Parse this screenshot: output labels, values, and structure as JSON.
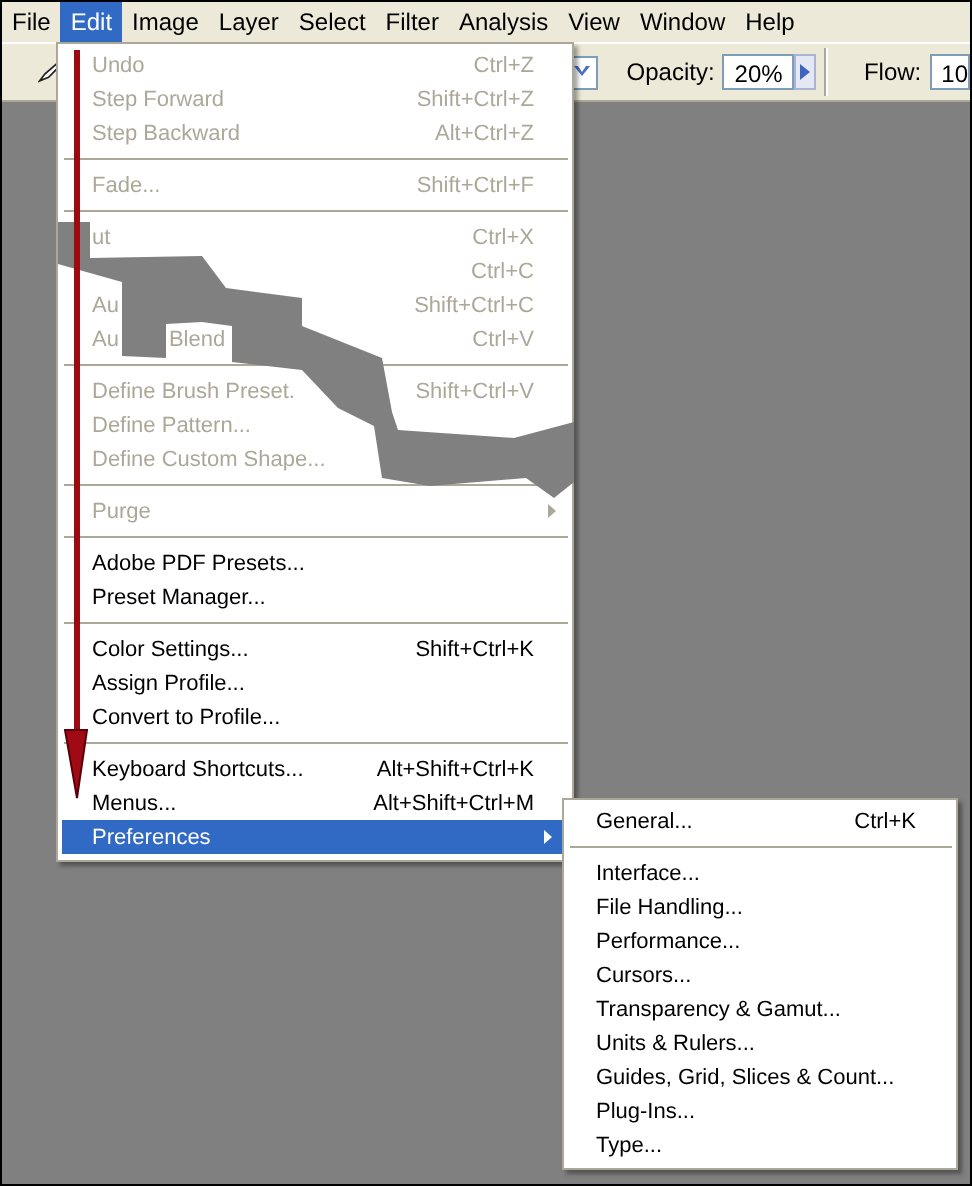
{
  "menubar": [
    {
      "label": "File",
      "selected": false
    },
    {
      "label": "Edit",
      "selected": true
    },
    {
      "label": "Image",
      "selected": false
    },
    {
      "label": "Layer",
      "selected": false
    },
    {
      "label": "Select",
      "selected": false
    },
    {
      "label": "Filter",
      "selected": false
    },
    {
      "label": "Analysis",
      "selected": false
    },
    {
      "label": "View",
      "selected": false
    },
    {
      "label": "Window",
      "selected": false
    },
    {
      "label": "Help",
      "selected": false
    }
  ],
  "toolbar": {
    "opacity": {
      "label": "Opacity:",
      "value": "20%"
    },
    "flow": {
      "label": "Flow:",
      "value": "10"
    }
  },
  "edit_menu": {
    "items": [
      {
        "kind": "item",
        "label": "Undo",
        "shortcut": "Ctrl+Z",
        "disabled": true,
        "submenu": false,
        "selected": false
      },
      {
        "kind": "item",
        "label": "Step Forward",
        "shortcut": "Shift+Ctrl+Z",
        "disabled": true,
        "submenu": false,
        "selected": false
      },
      {
        "kind": "item",
        "label": "Step Backward",
        "shortcut": "Alt+Ctrl+Z",
        "disabled": true,
        "submenu": false,
        "selected": false
      },
      {
        "kind": "separator"
      },
      {
        "kind": "item",
        "label": "Fade...",
        "shortcut": "Shift+Ctrl+F",
        "disabled": true,
        "submenu": false,
        "selected": false
      },
      {
        "kind": "separator"
      },
      {
        "kind": "item",
        "label": "ut",
        "shortcut": "Ctrl+X",
        "disabled": true,
        "submenu": false,
        "selected": false
      },
      {
        "kind": "item",
        "shortcut": "Ctrl+C",
        "disabled": true,
        "submenu": false,
        "selected": false
      },
      {
        "kind": "item",
        "label": "Au",
        "shortcut": "Shift+Ctrl+C",
        "disabled": true,
        "submenu": false,
        "selected": false
      },
      {
        "kind": "item",
        "label": "Au",
        "label_2": "Blend",
        "shortcut": "Ctrl+V",
        "disabled": true,
        "submenu": false,
        "selected": false
      },
      {
        "kind": "separator"
      },
      {
        "kind": "item",
        "label": "Define Brush Preset.",
        "shortcut": "Shift+Ctrl+V",
        "disabled": true,
        "submenu": false,
        "selected": false
      },
      {
        "kind": "item",
        "label": "Define Pattern...",
        "disabled": true,
        "submenu": false,
        "selected": false
      },
      {
        "kind": "item",
        "label": "Define Custom Shape...",
        "disabled": true,
        "submenu": false,
        "selected": false
      },
      {
        "kind": "separator"
      },
      {
        "kind": "item",
        "label": "Purge",
        "disabled": true,
        "submenu": true,
        "selected": false
      },
      {
        "kind": "separator"
      },
      {
        "kind": "item",
        "label": "Adobe PDF Presets...",
        "disabled": false,
        "submenu": false,
        "selected": false
      },
      {
        "kind": "item",
        "label": "Preset Manager...",
        "disabled": false,
        "submenu": false,
        "selected": false
      },
      {
        "kind": "separator"
      },
      {
        "kind": "item",
        "label": "Color Settings...",
        "shortcut": "Shift+Ctrl+K",
        "disabled": false,
        "submenu": false,
        "selected": false
      },
      {
        "kind": "item",
        "label": "Assign Profile...",
        "disabled": false,
        "submenu": false,
        "selected": false
      },
      {
        "kind": "item",
        "label": "Convert to Profile...",
        "disabled": false,
        "submenu": false,
        "selected": false
      },
      {
        "kind": "separator"
      },
      {
        "kind": "item",
        "label": "Keyboard Shortcuts...",
        "shortcut": "Alt+Shift+Ctrl+K",
        "disabled": false,
        "submenu": false,
        "selected": false
      },
      {
        "kind": "item",
        "label": "Menus...",
        "shortcut": "Alt+Shift+Ctrl+M",
        "disabled": false,
        "submenu": false,
        "selected": false
      },
      {
        "kind": "item",
        "label": "Preferences",
        "disabled": false,
        "submenu": true,
        "selected": true
      }
    ]
  },
  "preferences_submenu": {
    "items": [
      {
        "kind": "item",
        "label": "General...",
        "shortcut": "Ctrl+K"
      },
      {
        "kind": "separator"
      },
      {
        "kind": "item",
        "label": "Interface..."
      },
      {
        "kind": "item",
        "label": "File Handling..."
      },
      {
        "kind": "item",
        "label": "Performance..."
      },
      {
        "kind": "item",
        "label": "Cursors..."
      },
      {
        "kind": "item",
        "label": "Transparency & Gamut..."
      },
      {
        "kind": "item",
        "label": "Units & Rulers..."
      },
      {
        "kind": "item",
        "label": "Guides, Grid, Slices & Count..."
      },
      {
        "kind": "item",
        "label": "Plug-Ins..."
      },
      {
        "kind": "item",
        "label": "Type..."
      }
    ]
  }
}
